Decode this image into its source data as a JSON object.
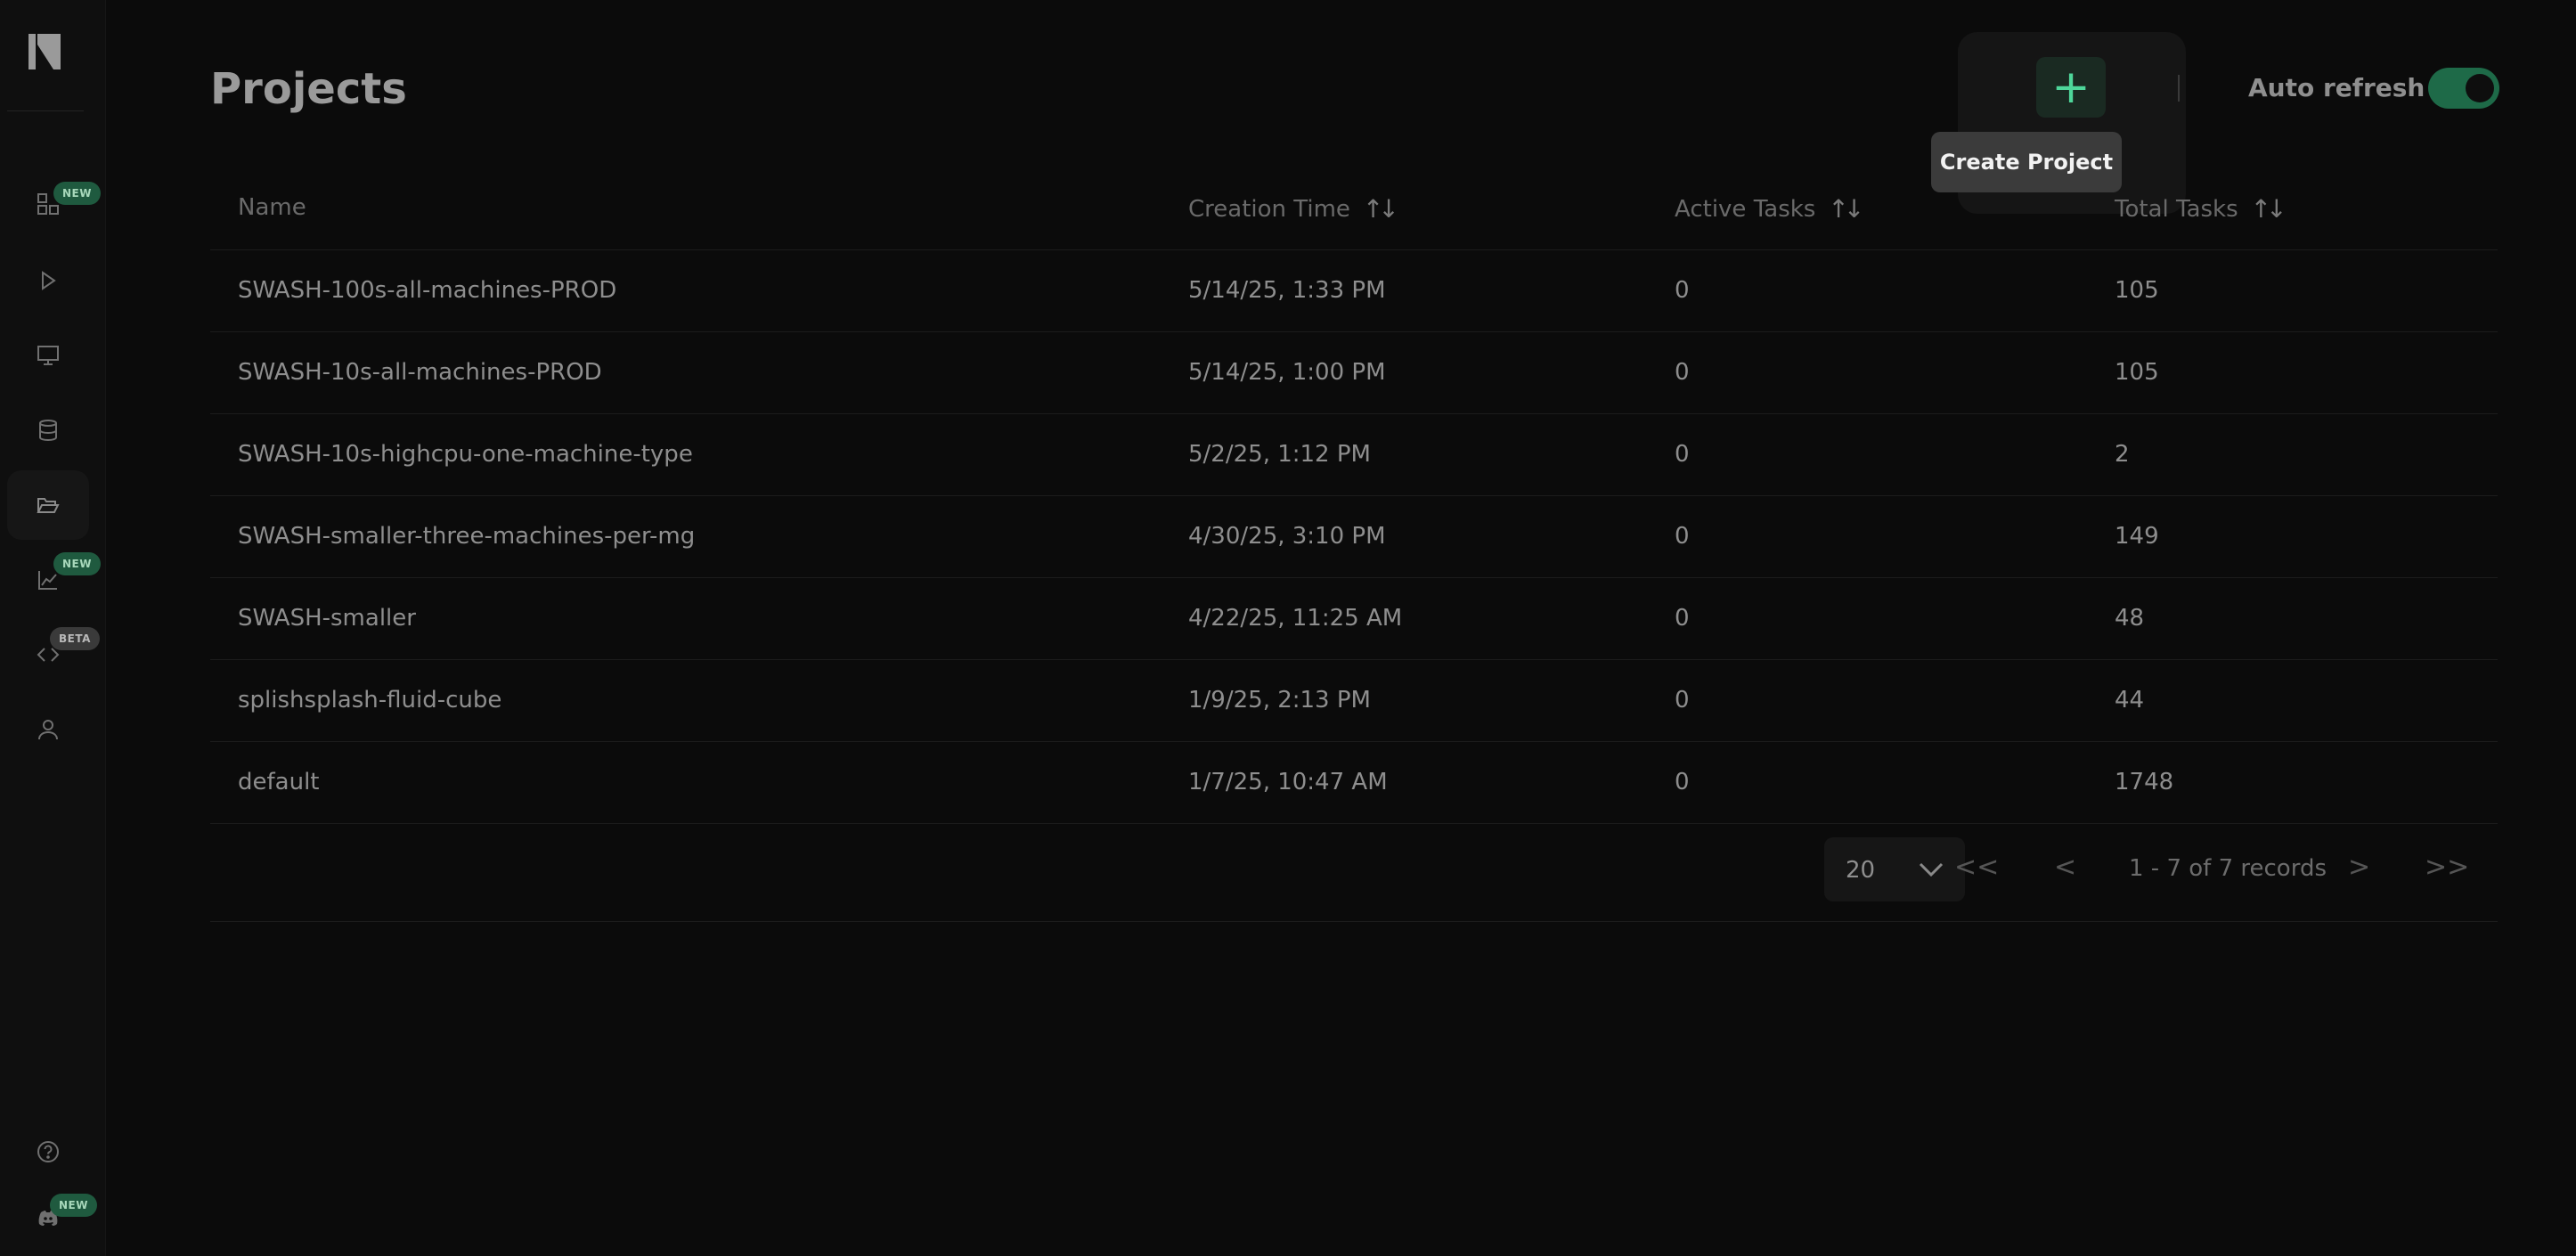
{
  "page": {
    "title": "Projects"
  },
  "sidebar": {
    "badges": {
      "dashboard": "NEW",
      "reports": "NEW",
      "code": "BETA",
      "discord": "NEW"
    }
  },
  "header": {
    "create_tooltip": "Create Project",
    "auto_refresh_label": "Auto refresh",
    "auto_refresh_on": true
  },
  "table": {
    "columns": [
      "Name",
      "Creation Time",
      "Active Tasks",
      "Total Tasks"
    ],
    "rows": [
      {
        "name": "SWASH-100s-all-machines-PROD",
        "created": "5/14/25, 1:33 PM",
        "active": "0",
        "total": "105"
      },
      {
        "name": "SWASH-10s-all-machines-PROD",
        "created": "5/14/25, 1:00 PM",
        "active": "0",
        "total": "105"
      },
      {
        "name": "SWASH-10s-highcpu-one-machine-type",
        "created": "5/2/25, 1:12 PM",
        "active": "0",
        "total": "2"
      },
      {
        "name": "SWASH-smaller-three-machines-per-mg",
        "created": "4/30/25, 3:10 PM",
        "active": "0",
        "total": "149"
      },
      {
        "name": "SWASH-smaller",
        "created": "4/22/25, 11:25 AM",
        "active": "0",
        "total": "48"
      },
      {
        "name": "splishsplash-fluid-cube",
        "created": "1/9/25, 2:13 PM",
        "active": "0",
        "total": "44"
      },
      {
        "name": "default",
        "created": "1/7/25, 10:47 AM",
        "active": "0",
        "total": "1748"
      }
    ]
  },
  "pagination": {
    "page_size": "20",
    "first": "<<",
    "prev": "<",
    "records_text": "1 - 7 of 7 records",
    "next": ">",
    "last": ">>"
  },
  "colors": {
    "accent": "#4ed69a",
    "toggle_on": "#1e6a48",
    "background": "#0b0b0b"
  }
}
